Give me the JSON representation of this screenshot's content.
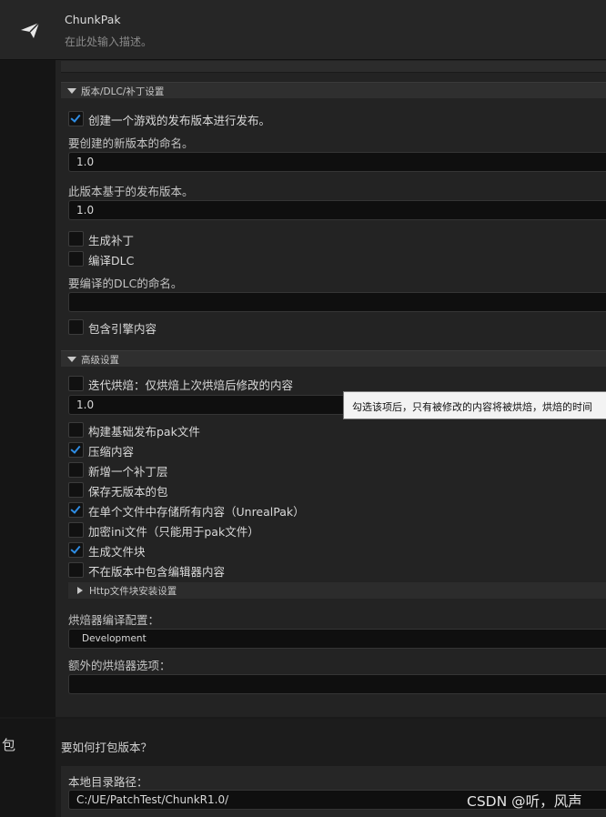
{
  "header": {
    "title": "ChunkPak",
    "description": "在此处输入描述。"
  },
  "release": {
    "section_label": "版本/DLC/补丁设置",
    "create_release_label": "创建一个游戏的发布版本进行发布。",
    "create_release_checked": true,
    "new_version_label": "要创建的新版本的命名。",
    "new_version_value": "1.0",
    "based_on_label": "此版本基于的发布版本。",
    "based_on_value": "1.0",
    "generate_patch_label": "生成补丁",
    "generate_patch_checked": false,
    "build_dlc_label": "编译DLC",
    "build_dlc_checked": false,
    "dlc_name_label": "要编译的DLC的命名。",
    "dlc_name_value": "",
    "include_engine_label": "包含引擎内容",
    "include_engine_checked": false
  },
  "advanced": {
    "section_label": "高级设置",
    "iterative_cook_label": "迭代烘焙：仅烘焙上次烘焙后修改的内容",
    "iterative_cook_value": "1.0",
    "tooltip": "勾选该项后，只有被修改的内容将被烘焙，烘焙的时间",
    "options": [
      {
        "label": "构建基础发布pak文件",
        "checked": false
      },
      {
        "label": "压缩内容",
        "checked": true
      },
      {
        "label": "新增一个补丁层",
        "checked": false
      },
      {
        "label": "保存无版本的包",
        "checked": false
      },
      {
        "label": "在单个文件中存储所有内容（UnrealPak）",
        "checked": true
      },
      {
        "label": "加密ini文件（只能用于pak文件）",
        "checked": false
      },
      {
        "label": "生成文件块",
        "checked": true
      },
      {
        "label": "不在版本中包含编辑器内容",
        "checked": false
      }
    ],
    "http_section_label": "Http文件块安装设置",
    "cooker_config_label": "烘焙器编译配置：",
    "cooker_config_value": "Development",
    "extra_cooker_label": "额外的烘焙器选项：",
    "extra_cooker_value": ""
  },
  "package": {
    "side_label": "包",
    "question": "要如何打包版本？",
    "local_dir_label": "本地目录路径：",
    "local_dir_value": "C:/UE/PatchTest/ChunkR1.0/"
  },
  "watermark": "CSDN @听，风声",
  "colors": {
    "accent": "#2f8de4",
    "panel": "#232323",
    "input": "#0f0f0f"
  }
}
